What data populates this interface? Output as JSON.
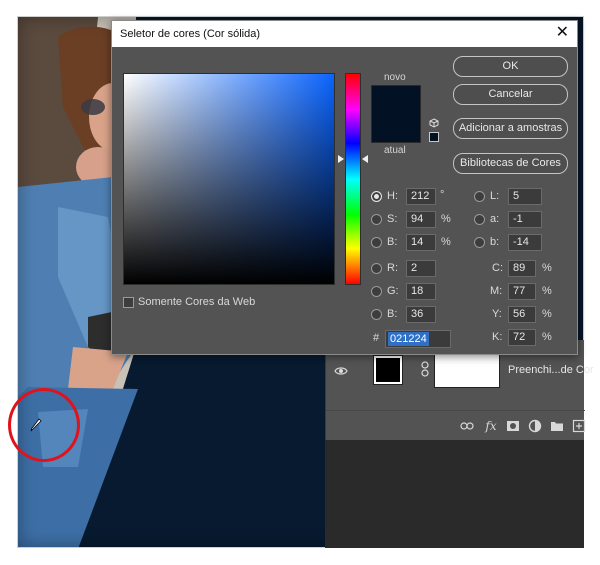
{
  "dialog": {
    "title": "Seletor de cores (Cor sólida)",
    "close_glyph": "✕",
    "new_label": "novo",
    "current_label": "atual",
    "web_colors_label": "Somente Cores da Web",
    "web_colors_checked": false,
    "new_color": "#021224",
    "current_color": "#021224",
    "buttons": {
      "ok": "OK",
      "cancel": "Cancelar",
      "add_to_swatches": "Adicionar a amostras",
      "color_libraries": "Bibliotecas de Cores"
    },
    "hsb": {
      "h": {
        "label": "H:",
        "value": "212",
        "unit": "°"
      },
      "s": {
        "label": "S:",
        "value": "94",
        "unit": "%"
      },
      "b": {
        "label": "B:",
        "value": "14",
        "unit": "%"
      }
    },
    "rgb": {
      "r": {
        "label": "R:",
        "value": "2"
      },
      "g": {
        "label": "G:",
        "value": "18"
      },
      "b": {
        "label": "B:",
        "value": "36"
      }
    },
    "lab": {
      "l": {
        "label": "L:",
        "value": "5"
      },
      "a": {
        "label": "a:",
        "value": "-1"
      },
      "b": {
        "label": "b:",
        "value": "-14"
      }
    },
    "cmyk": {
      "c": {
        "label": "C:",
        "value": "89",
        "unit": "%"
      },
      "m": {
        "label": "M:",
        "value": "77",
        "unit": "%"
      },
      "y": {
        "label": "Y:",
        "value": "56",
        "unit": "%"
      },
      "k": {
        "label": "K:",
        "value": "72",
        "unit": "%"
      }
    },
    "hex": {
      "label": "#",
      "value": "021224"
    },
    "selected_channel": "H"
  },
  "layers_panel": {
    "layer_name": "Preenchi...de Cor"
  },
  "icons": [
    "close-icon",
    "cube-icon",
    "eye-icon",
    "link-icon",
    "fx-icon",
    "mask-icon",
    "adjustment-icon",
    "folder-icon",
    "new-layer-icon",
    "eyedropper-icon"
  ],
  "colors": {
    "background_navy": "#071a30",
    "annotation_red": "#e0131b",
    "dialog_bg": "#535353"
  }
}
